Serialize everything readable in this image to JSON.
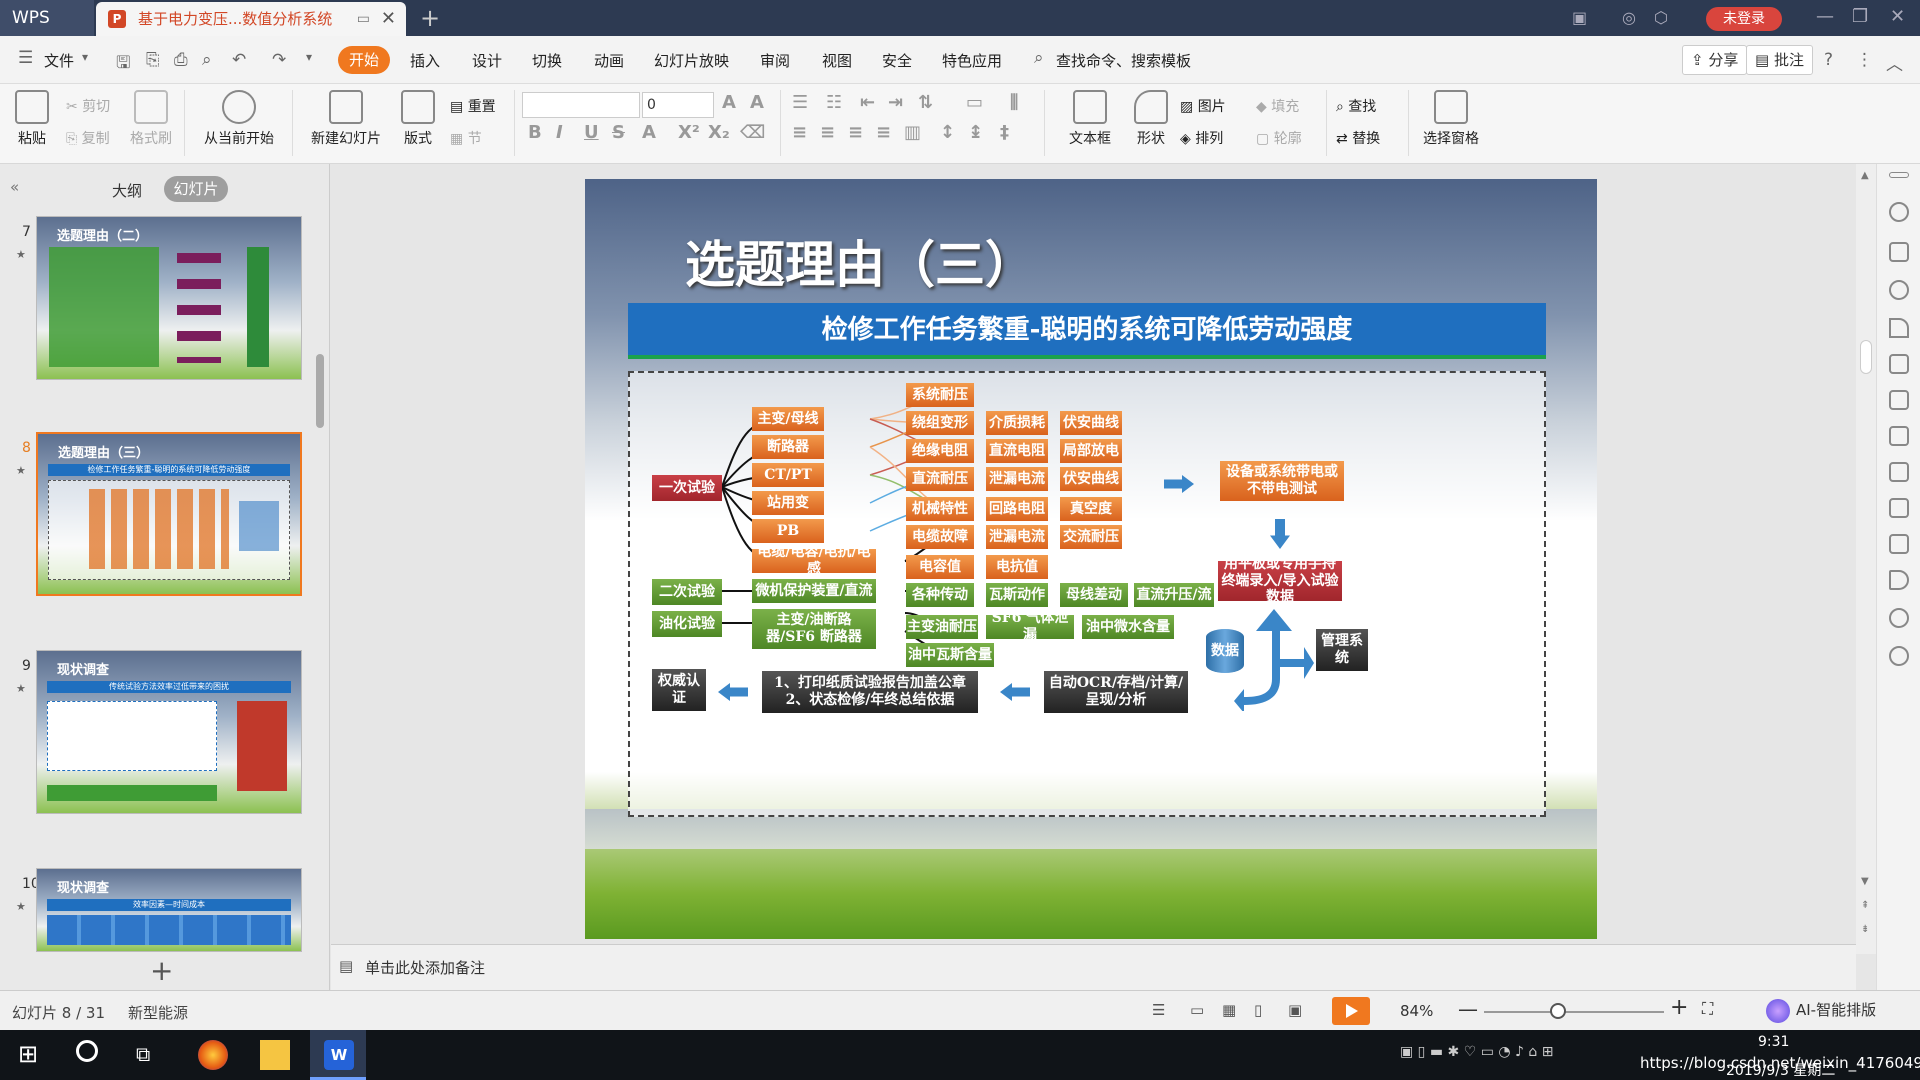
{
  "app": {
    "logo": "WPS",
    "doc_tab": "基于电力变压...数值分析系统",
    "login": "未登录"
  },
  "menu": {
    "file": "文件",
    "tabs": [
      "开始",
      "插入",
      "设计",
      "切换",
      "动画",
      "幻灯片放映",
      "审阅",
      "视图",
      "安全",
      "特色应用"
    ],
    "search": "查找命令、搜索模板",
    "share": "分享",
    "comment": "批注"
  },
  "ribbon": {
    "paste": "粘贴",
    "cut": "剪切",
    "copy": "复制",
    "format_painter": "格式刷",
    "from_current": "从当前开始",
    "new_slide": "新建幻灯片",
    "layout": "版式",
    "reset": "重置",
    "section": "节",
    "font_size": "0",
    "textbox": "文本框",
    "shape": "形状",
    "arrange": "排列",
    "picture": "图片",
    "fill": "填充",
    "outline": "轮廓",
    "find": "查找",
    "replace": "替换",
    "selection_pane": "选择窗格"
  },
  "panel": {
    "outline_tab": "大纲",
    "slides_tab": "幻灯片"
  },
  "thumbs": [
    {
      "num": "7",
      "title": "选题理由（二）"
    },
    {
      "num": "8",
      "title": "选题理由（三）",
      "bar": "检修工作任务繁重-聪明的系统可降低劳动强度"
    },
    {
      "num": "9",
      "title": "现状调查",
      "bar": "传统试验方法效率过低带来的困扰"
    },
    {
      "num": "10",
      "title": "现状调查",
      "bar": "效率因素—时间成本"
    }
  ],
  "slide": {
    "title": "选题理由（三）",
    "banner": "检修工作任务繁重-聪明的系统可降低劳动强度",
    "primary": "一次试验",
    "secondary": "二次试验",
    "oil": "油化试验",
    "equip": [
      "主变/母线",
      "断路器",
      "CT/PT",
      "站用变",
      "PB",
      "电缆/电容/电抗/电感"
    ],
    "tests_col1": [
      "系统耐压",
      "绕组变形",
      "绝缘电阻",
      "直流耐压",
      "机械特性",
      "电缆故障",
      "电容值"
    ],
    "tests_col2": [
      "介质损耗",
      "直流电阻",
      "泄漏电流",
      "回路电阻",
      "泄漏电流",
      "电抗值"
    ],
    "tests_col3": [
      "伏安曲线",
      "局部放电",
      "伏安曲线",
      "真空度",
      "交流耐压"
    ],
    "secondary_equip": "微机保护装置/直流",
    "secondary_tests": [
      "各种传动",
      "瓦斯动作",
      "母线差动",
      "直流升压/流"
    ],
    "oil_equip": "主变/油断路器/SF6 断路器",
    "oil_tests": [
      "主变油耐压",
      "SF6 气体泄漏",
      "油中微水含量",
      "油中瓦斯含量"
    ],
    "device": "设备或系统带电或不带电测试",
    "tablet": "用平板或专用手持终端录入/导入试验数据",
    "db": "数据",
    "mgmt": "管理系统",
    "ocr": "自动OCR/存档/计算/呈现/分析",
    "print1": "1、打印纸质试验报告加盖公章",
    "print2": "2、状态检修/年终总结依据",
    "auth": "权威认证"
  },
  "note": "单击此处添加备注",
  "status": {
    "slide_count": "幻灯片 8 / 31",
    "theme": "新型能源",
    "zoom": "84%",
    "ai": "AI-智能排版"
  },
  "taskbar": {
    "time": "9:31",
    "date": "2019/9/3 星期二",
    "url": "https://blog.csdn.net/weixin_41760494"
  }
}
